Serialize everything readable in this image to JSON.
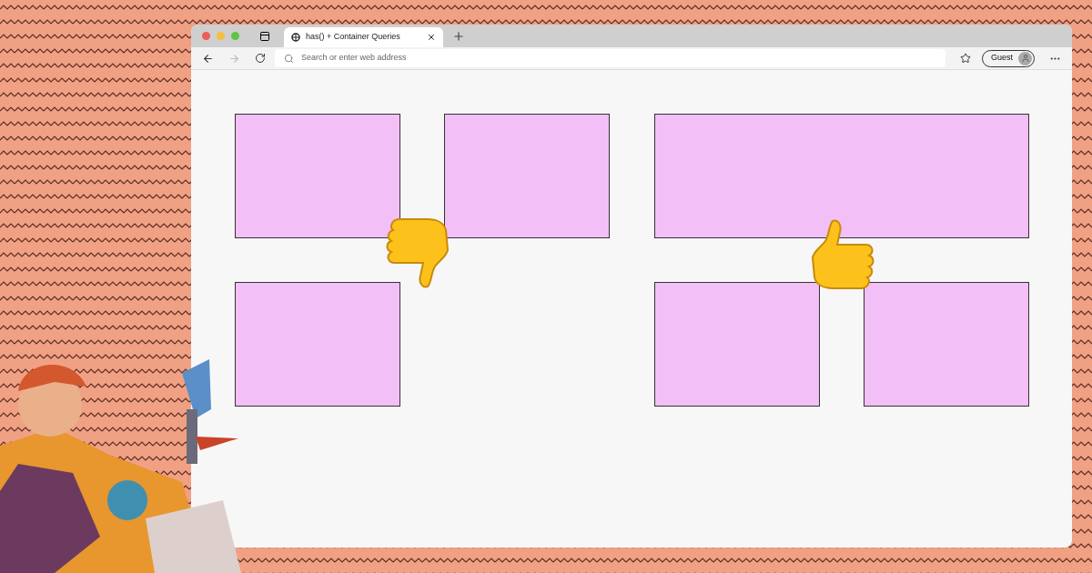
{
  "tab": {
    "title": "has() + Container Queries",
    "selected": true
  },
  "address_bar": {
    "placeholder": "Search or enter web address"
  },
  "profile": {
    "label": "Guest"
  },
  "demos": [
    {
      "kind": "thumbs-down"
    },
    {
      "kind": "thumbs-up"
    }
  ]
}
